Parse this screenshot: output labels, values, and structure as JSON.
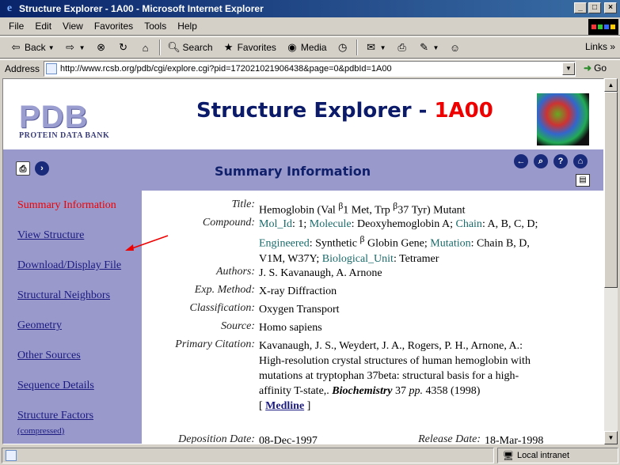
{
  "window": {
    "title": "Structure Explorer - 1A00 - Microsoft Internet Explorer"
  },
  "menu": [
    "File",
    "Edit",
    "View",
    "Favorites",
    "Tools",
    "Help"
  ],
  "toolbar": {
    "back": "Back",
    "search": "Search",
    "favorites": "Favorites",
    "media": "Media"
  },
  "links_label": "Links",
  "address": {
    "label": "Address",
    "url": "http://www.rcsb.org/pdb/cgi/explore.cgi?pid=172021021906438&page=0&pdbId=1A00",
    "go": "Go"
  },
  "status": {
    "zone": "Local intranet"
  },
  "page": {
    "logo": {
      "letters": "PDB",
      "subtitle": "PROTEIN DATA BANK"
    },
    "heading": "Structure Explorer - ",
    "heading_id": "1A00",
    "section_title": "Summary Information",
    "nav": [
      "Summary Information",
      "View Structure",
      "Download/Display File",
      "Structural Neighbors",
      "Geometry",
      "Other Sources",
      "Sequence Details",
      "Structure Factors"
    ],
    "nav_sub": "(compressed)",
    "fields": {
      "title_label": "Title:",
      "title_a": "Hemoglobin (Val ",
      "title_beta1": "β",
      "title_b": "1 Met, Trp ",
      "title_beta2": "β",
      "title_c": "37 Tyr) Mutant",
      "compound_label": "Compound:",
      "molid_key": "Mol_Id",
      "molid_val": ": 1; ",
      "molecule_key": "Molecule",
      "molecule_val": ": Deoxyhemoglobin A; ",
      "chain_key": "Chain",
      "chain_val": ": A, B, C, D;",
      "engineered_key": "Engineered",
      "engineered_val": ": Synthetic ",
      "engineered_beta": "β",
      "engineered_val2": " Globin Gene; ",
      "mutation_key": "Mutation",
      "mutation_val": ": Chain B, D,",
      "mutation_val2": "V1M, W37Y; ",
      "bio_key": "Biological_Unit",
      "bio_val": ": Tetramer",
      "authors_label": "Authors:",
      "authors": "J. S. Kavanaugh, A. Arnone",
      "exp_label": "Exp. Method:",
      "exp": "X-ray Diffraction",
      "class_label": "Classification:",
      "class": "Oxygen Transport",
      "source_label": "Source:",
      "source": "Homo sapiens",
      "citation_label": "Primary Citation:",
      "citation_1": "Kavanaugh, J. S., Weydert, J. A., Rogers, P. H., Arnone, A.:",
      "citation_2": "High-resolution crystal structures of human hemoglobin with",
      "citation_3": "mutations at tryptophan 37beta: structural basis for a high-",
      "citation_4a": "affinity T-state,. ",
      "citation_journal": "Biochemistry",
      "citation_vol": " 37 ",
      "citation_pp": "pp.",
      "citation_4b": " 4358 (1998)",
      "medline_open": "[ ",
      "medline": "Medline",
      "medline_close": " ]",
      "deposition_label": "Deposition Date:",
      "deposition": "08-Dec-1997",
      "release_label": "Release Date:",
      "release": "18-Mar-1998"
    }
  }
}
